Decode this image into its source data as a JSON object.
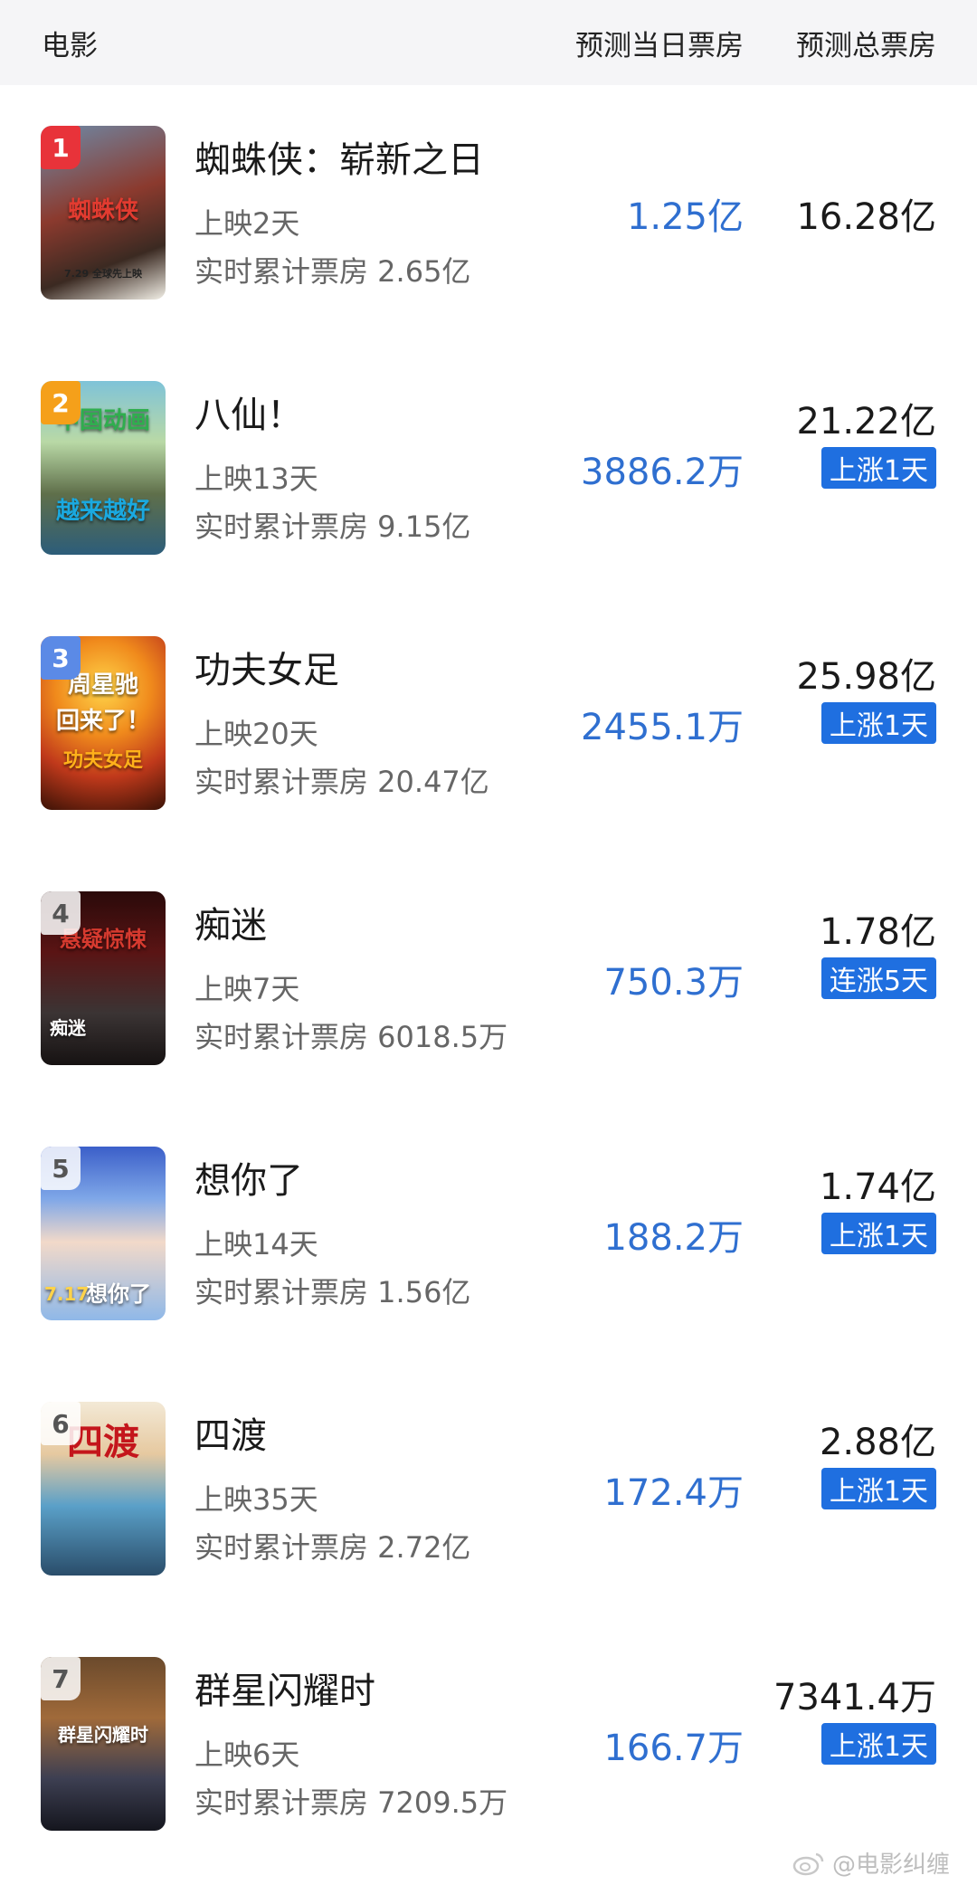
{
  "header": {
    "movie": "电影",
    "today": "预测当日票房",
    "total": "预测总票房"
  },
  "movies": [
    {
      "rank": "1",
      "title": "蜘蛛侠：崭新之日",
      "days": "上映2天",
      "cumulative": "实时累计票房 2.65亿",
      "today_box": "1.25亿",
      "total_box": "16.28亿",
      "badge": "",
      "poster_text": "蜘蛛侠",
      "poster_date": "7.29 全球先上映"
    },
    {
      "rank": "2",
      "title": "八仙！",
      "days": "上映13天",
      "cumulative": "实时累计票房 9.15亿",
      "today_box": "3886.2万",
      "total_box": "21.22亿",
      "badge": "上涨1天",
      "poster_text": "中国动画",
      "poster_sub": "越来越好"
    },
    {
      "rank": "3",
      "title": "功夫女足",
      "days": "上映20天",
      "cumulative": "实时累计票房 20.47亿",
      "today_box": "2455.1万",
      "total_box": "25.98亿",
      "badge": "上涨1天",
      "poster_text": "周星驰",
      "poster_sub": "回来了！",
      "poster_sub2": "功夫女足"
    },
    {
      "rank": "4",
      "title": "痴迷",
      "days": "上映7天",
      "cumulative": "实时累计票房 6018.5万",
      "today_box": "750.3万",
      "total_box": "1.78亿",
      "badge": "连涨5天",
      "poster_text": "悬疑惊悚",
      "poster_sub": "痴迷"
    },
    {
      "rank": "5",
      "title": "想你了",
      "days": "上映14天",
      "cumulative": "实时累计票房 1.56亿",
      "today_box": "188.2万",
      "total_box": "1.74亿",
      "badge": "上涨1天",
      "poster_text": "想你了",
      "poster_date": "7.17"
    },
    {
      "rank": "6",
      "title": "四渡",
      "days": "上映35天",
      "cumulative": "实时累计票房 2.72亿",
      "today_box": "172.4万",
      "total_box": "2.88亿",
      "badge": "上涨1天",
      "poster_text": "四渡"
    },
    {
      "rank": "7",
      "title": "群星闪耀时",
      "days": "上映6天",
      "cumulative": "实时累计票房 7209.5万",
      "today_box": "166.7万",
      "total_box": "7341.4万",
      "badge": "上涨1天",
      "poster_text": "群星闪耀时"
    }
  ],
  "watermark": "@电影纠缠",
  "colors": {
    "today_blue": "#2f6fd0",
    "badge_blue": "#1f6fe0",
    "rank1": "#e8333a",
    "rank2": "#f5a01a",
    "rank3": "#5b8ae6"
  }
}
